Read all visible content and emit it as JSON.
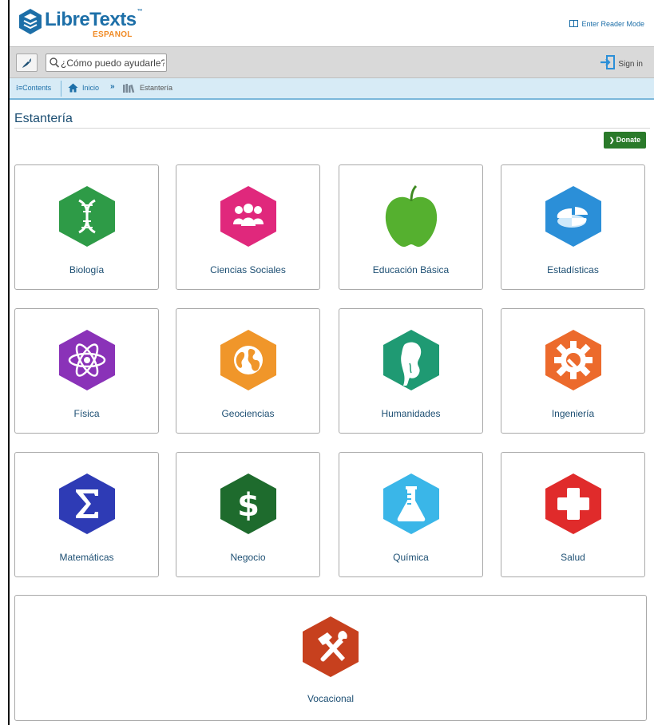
{
  "header": {
    "logo_text": "LibreTexts",
    "logo_tm": "™",
    "logo_subtitle": "ESPANOL",
    "reader_mode": "Enter Reader Mode"
  },
  "toolbar": {
    "search_placeholder": "¿Cómo puedo ayudarle?",
    "sign_in": "Sign in"
  },
  "breadcrumb": {
    "contents": "Contents",
    "home": "Inicio",
    "separator": "»",
    "current": "Estantería"
  },
  "page": {
    "title": "Estantería",
    "donate": "Donate"
  },
  "shelves": [
    {
      "label": "Biología",
      "icon": "dna-icon",
      "color": "#2e9b47"
    },
    {
      "label": "Ciencias Sociales",
      "icon": "people-icon",
      "color": "#e0287c"
    },
    {
      "label": "Educación Básica",
      "icon": "apple-icon",
      "color": "#55b02f"
    },
    {
      "label": "Estadísticas",
      "icon": "pie-chart-icon",
      "color": "#2b8fd8"
    },
    {
      "label": "Física",
      "icon": "atom-icon",
      "color": "#8a32b8"
    },
    {
      "label": "Geociencias",
      "icon": "globe-icon",
      "color": "#f0962a"
    },
    {
      "label": "Humanidades",
      "icon": "bust-icon",
      "color": "#1f9a73"
    },
    {
      "label": "Ingeniería",
      "icon": "gear-wrench-icon",
      "color": "#ec6a2c"
    },
    {
      "label": "Matemáticas",
      "icon": "sigma-icon",
      "color": "#2e3bb5"
    },
    {
      "label": "Negocio",
      "icon": "dollar-icon",
      "color": "#1e6b2d"
    },
    {
      "label": "Química",
      "icon": "flask-icon",
      "color": "#3ab6e8"
    },
    {
      "label": "Salud",
      "icon": "cross-icon",
      "color": "#e02b2b"
    },
    {
      "label": "Vocacional",
      "icon": "hammer-wrench-icon",
      "color": "#c7401e"
    }
  ]
}
